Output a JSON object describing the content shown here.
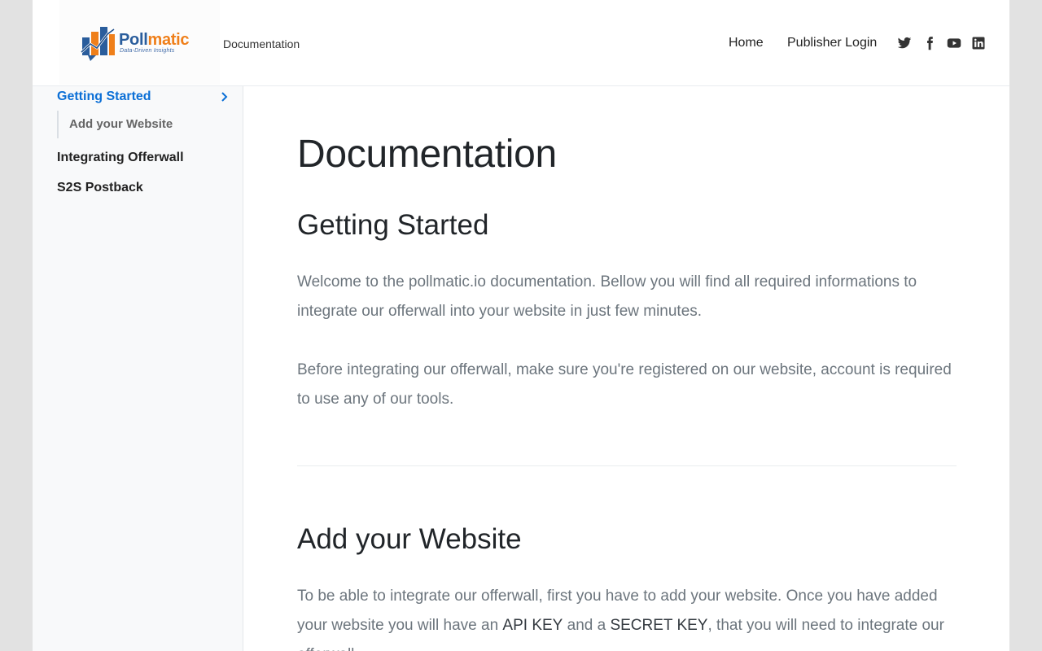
{
  "header": {
    "logo": {
      "word_main": "Poll",
      "word_tail": "matic",
      "tagline": "Data-Driven Insights"
    },
    "brand_link": "Documentation",
    "nav": {
      "home": "Home",
      "login": "Publisher Login"
    },
    "social_icons": [
      "twitter-icon",
      "facebook-icon",
      "youtube-icon",
      "linkedin-icon"
    ]
  },
  "sidebar": {
    "items": [
      {
        "label": "Getting Started",
        "active": true
      },
      {
        "label": "Add your Website",
        "sub": true
      },
      {
        "label": "Integrating Offerwall"
      },
      {
        "label": "S2S Postback"
      }
    ]
  },
  "main": {
    "title": "Documentation",
    "getting_started": {
      "heading": "Getting Started",
      "p1": "Welcome to the pollmatic.io documentation. Bellow you will find all required informations to integrate our offerwall into your website in just few minutes.",
      "p2": "Before integrating our offerwall, make sure you're registered on our website, account is required to use any of our tools."
    },
    "add_website": {
      "heading": "Add your Website",
      "p_part1": "To be able to integrate our offerwall, first you have to add your website. Once you have added your website you will have an ",
      "api_key": "API KEY",
      "p_part2": " and a ",
      "secret_key": "SECRET KEY",
      "p_part3": ", that you will need to integrate our offerwall."
    }
  },
  "colors": {
    "accent": "#0b6fd6",
    "logo_blue": "#2a5d9c",
    "logo_orange": "#ef7f1a",
    "text_muted": "#6c757d",
    "heading": "#212529",
    "sidebar_bg": "#f8f9fa",
    "outer_bg": "#e2e2e2"
  }
}
